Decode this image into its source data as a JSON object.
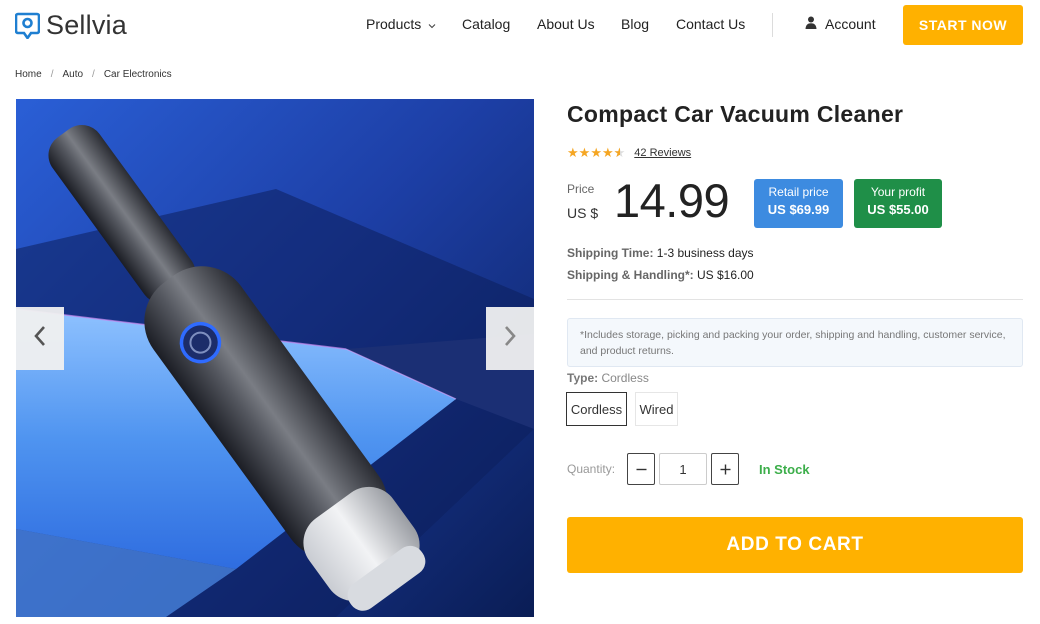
{
  "brand": {
    "name": "Sellvia"
  },
  "nav": {
    "items": [
      {
        "label": "Products",
        "has_dropdown": true
      },
      {
        "label": "Catalog"
      },
      {
        "label": "About Us"
      },
      {
        "label": "Blog"
      },
      {
        "label": "Contact Us"
      }
    ],
    "account_label": "Account",
    "cta_label": "START NOW"
  },
  "breadcrumb": [
    "Home",
    "Auto",
    "Car Electronics"
  ],
  "product": {
    "title": "Compact Car Vacuum Cleaner",
    "rating": 4.5,
    "reviews_label": "42 Reviews",
    "price_label": "Price",
    "currency": "US $",
    "price": "14.99",
    "retail": {
      "label": "Retail price",
      "value": "US $69.99"
    },
    "profit": {
      "label": "Your profit",
      "value": "US $55.00"
    },
    "shipping_time": {
      "key": "Shipping Time:",
      "value": "1-3 business days"
    },
    "shipping_handling": {
      "key": "Shipping & Handling*:",
      "value": "US $16.00"
    },
    "note": "*Includes storage, picking and packing your order, shipping and handling, customer service, and product returns.",
    "type": {
      "key": "Type:",
      "value": "Cordless",
      "options": [
        "Cordless",
        "Wired"
      ],
      "selected": "Cordless"
    },
    "quantity": {
      "label": "Quantity:",
      "value": "1"
    },
    "stock_label": "In Stock",
    "add_to_cart_label": "ADD TO CART"
  },
  "colors": {
    "accent": "#ffb100",
    "retail_badge": "#3d8be0",
    "profit_badge": "#1f8f48",
    "in_stock": "#3cae4a",
    "star": "#f5a623"
  }
}
